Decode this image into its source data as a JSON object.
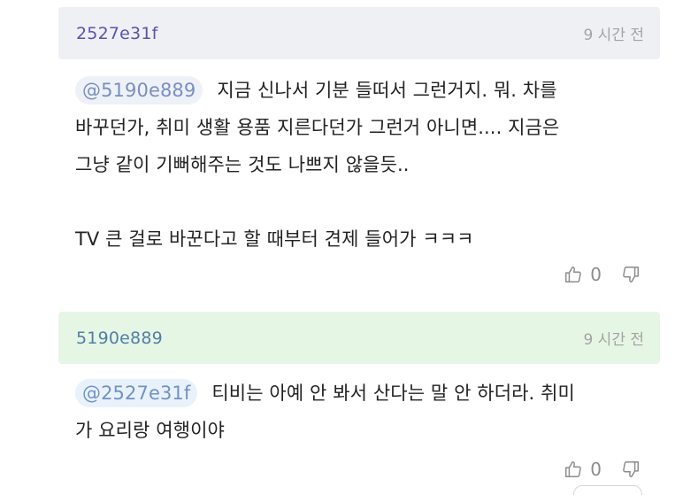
{
  "comments": [
    {
      "author": "2527e31f",
      "time": "9 시간 전",
      "mention": "@5190e889",
      "lines": [
        "지금 신나서 기분 들떠서 그런거지. 뭐. 차를",
        "바꾸던가, 취미 생활 용품 지른다던가 그런거 아니면.... 지금은",
        "그냥 같이 기뻐해주는 것도 나쁘지 않을듯..",
        "",
        "TV 큰 걸로 바꾼다고 할 때부터 견제 들어가 ㅋㅋㅋ"
      ],
      "likes": "0",
      "like_icon": "thumbs-up-icon",
      "dislike_icon": "thumbs-down-icon"
    },
    {
      "author": "5190e889",
      "time": "9 시간 전",
      "mention": "@2527e31f",
      "lines": [
        "티비는 아예 안 봐서 산다는 말 안 하더라. 취미",
        "가 요리랑 여행이야"
      ],
      "likes": "0",
      "like_icon": "thumbs-up-icon",
      "dislike_icon": "thumbs-down-icon"
    }
  ],
  "colors": {
    "header_bg_1": "#eef0f4",
    "header_bg_2": "#e6f6e4",
    "author_1": "#5b52b0",
    "author_2": "#4f7fa6",
    "mention_text": "#7a8fbf",
    "time": "#a3a3a3"
  }
}
